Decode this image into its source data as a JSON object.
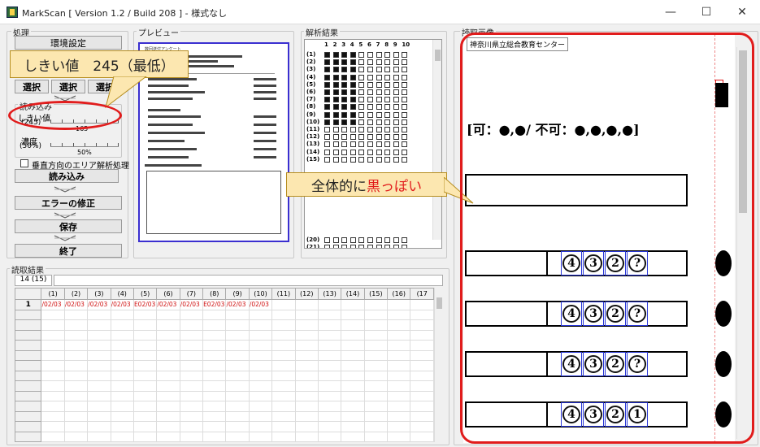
{
  "window": {
    "title": "MarkScan [ Version 1.2 / Build 208 ] - 様式なし",
    "minimize": "—",
    "maximize": "☐",
    "close": "✕"
  },
  "process": {
    "group_label": "処理",
    "env_button": "環境設定",
    "select_buttons": [
      "選択",
      "選択",
      "選択"
    ],
    "read_settings_label": "読み込み",
    "threshold_label": "しきい値",
    "threshold_value": "(245)",
    "threshold_slider": "165",
    "density_label": "濃度",
    "density_value": "(50%)",
    "density_slider": "50%",
    "vertical_check_label": "垂直方向のエリア解析処理",
    "load_button": "読み込み",
    "fix_button": "エラーの修正",
    "save_button": "保存",
    "exit_button": "終了"
  },
  "preview": {
    "group_label": "プレビュー",
    "sheet_title": "数回送付アンケート"
  },
  "analysis": {
    "group_label": "解析結果",
    "columns": [
      "1",
      "2",
      "3",
      "4",
      "5",
      "6",
      "7",
      "8",
      "9",
      "10"
    ],
    "rows": [
      "(1)",
      "(2)",
      "(3)",
      "(4)",
      "(5)",
      "(6)",
      "(7)",
      "(8)",
      "(9)",
      "(10)",
      "(11)",
      "(12)",
      "(13)",
      "(14)",
      "(15)",
      "(20)",
      "(21)",
      "(22)",
      "(23)",
      "(24)",
      "(25)"
    ],
    "filled_rows": 10,
    "filled_columns": 4
  },
  "results": {
    "group_label": "読取結果",
    "count": "14 (15)",
    "columns": [
      "(1)",
      "(2)",
      "(3)",
      "(4)",
      "(5)",
      "(6)",
      "(7)",
      "(8)",
      "(9)",
      "(10)",
      "(11)",
      "(12)",
      "(13)",
      "(14)",
      "(15)",
      "(16)",
      "(17"
    ],
    "rows": [
      {
        "no": "1",
        "cells": [
          "/02/03",
          "/02/03",
          "/02/03",
          "/02/03",
          "E02/03",
          "/02/03",
          "/02/03",
          "E02/03",
          "/02/03",
          "/02/03",
          "",
          "",
          "",
          "",
          "",
          "",
          ""
        ]
      }
    ]
  },
  "scan": {
    "group_label": "読取画像",
    "institution": "神奈川県立総合教育センター",
    "header_text": "[可：●,●/ 不可：●,●,●,●]",
    "rows": [
      {
        "marks": [
          "4",
          "3",
          "2",
          "?"
        ]
      },
      {
        "marks": [
          "4",
          "3",
          "2",
          "?"
        ]
      },
      {
        "marks": [
          "4",
          "3",
          "2",
          "?"
        ]
      },
      {
        "marks": [
          "4",
          "3",
          "2",
          "1"
        ]
      }
    ]
  },
  "annotations": {
    "threshold_callout": "しきい値　245（最低）",
    "dark_callout_prefix": "全体的に",
    "dark_callout_highlight": "黒っぽい",
    "highlight_color": "#e11c1c",
    "accent_color": "#3a2fd0"
  }
}
